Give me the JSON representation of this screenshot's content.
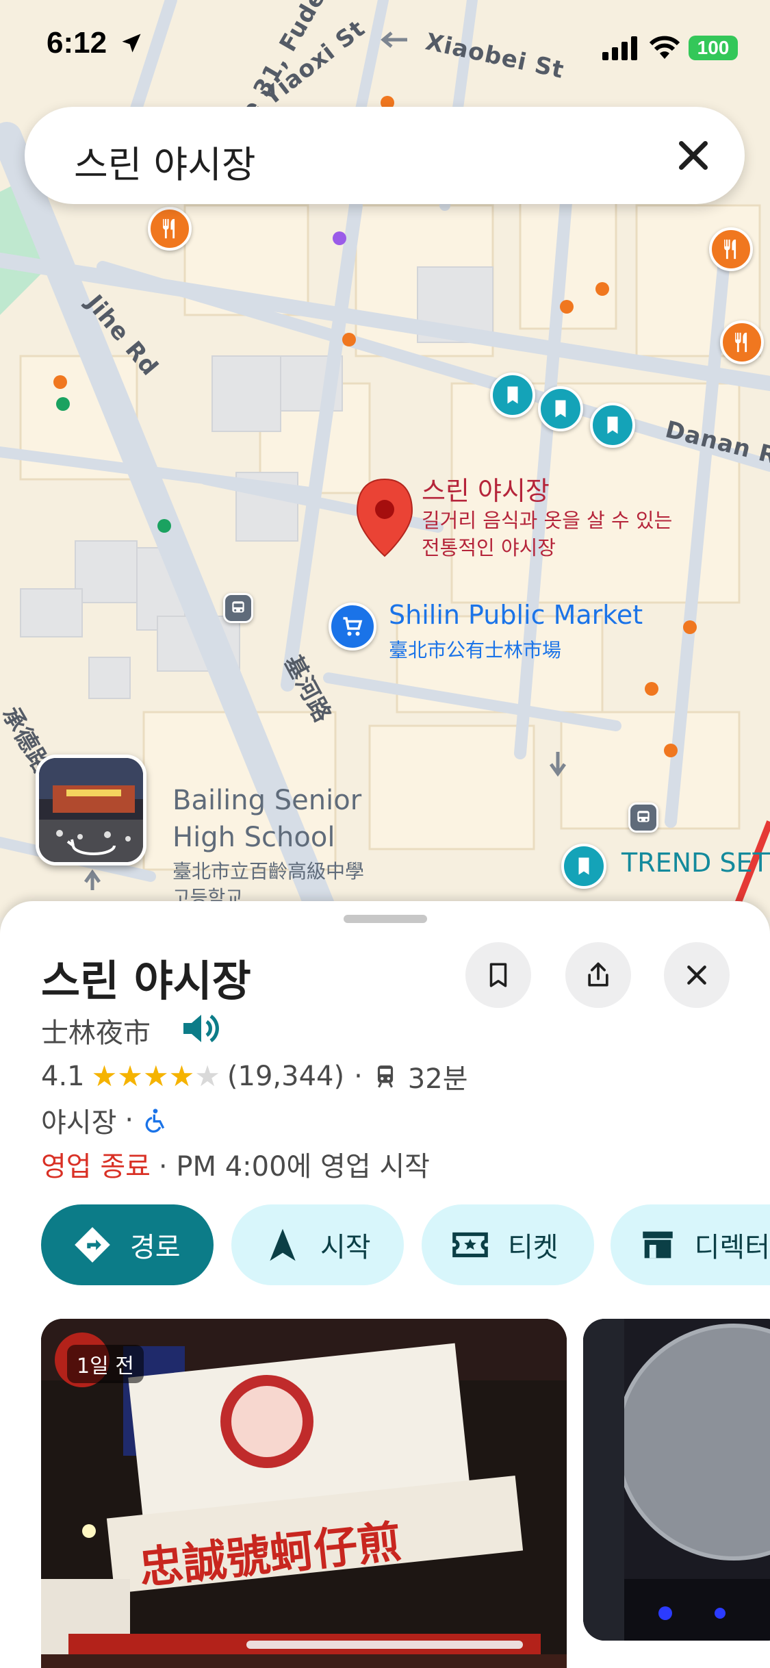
{
  "status_bar": {
    "time": "6:12",
    "battery": "100"
  },
  "search": {
    "query": "스린 야시장"
  },
  "map": {
    "streets": [
      "Xiaobei St",
      "Yiaoxi St",
      "Jihe Rd",
      "Danan Rd",
      "基河路"
    ],
    "street_partial": "ne 31, Fude",
    "marker": {
      "title": "스린 야시장",
      "description": "길거리 음식과 옷을 살 수 있는 전통적인 야시장"
    },
    "market": {
      "name": "Shilin Public Market",
      "native": "臺北市公有士林市場"
    },
    "school": {
      "name": "Bailing Senior High School",
      "native": "臺北市立百齡高級中學",
      "korean": "고등학교"
    },
    "trend": "TREND SETT",
    "partial_left": "承德路四"
  },
  "place": {
    "title": "스린 야시장",
    "native_name": "士林夜市",
    "rating": "4.1",
    "stars": 4.1,
    "review_count": "(19,344)",
    "separator": "·",
    "transit_time": "32분",
    "category": "야시장",
    "hours_status": "영업 종료",
    "hours_next": "· PM 4:00에 영업 시작"
  },
  "actions": {
    "directions": "경로",
    "start": "시작",
    "tickets": "티켓",
    "directory": "디렉터"
  },
  "photos": {
    "badge": "1일 전"
  },
  "icons": [
    "location-arrow-icon",
    "cellular-signal-icon",
    "wifi-icon",
    "battery-icon",
    "close-icon",
    "restaurant-icon",
    "bookmark-icon",
    "transit-icon",
    "map-pin-icon",
    "shopping-cart-icon",
    "street-view-icon",
    "save-icon",
    "share-icon",
    "speaker-icon",
    "train-icon",
    "wheelchair-icon",
    "directions-icon",
    "navigation-arrow-icon",
    "ticket-icon",
    "store-icon"
  ],
  "colors": {
    "accent": "#0c7c88",
    "chip_bg": "#d8f6fb",
    "closed": "#d93025",
    "star": "#f5b300",
    "pin": "#ea4335"
  }
}
